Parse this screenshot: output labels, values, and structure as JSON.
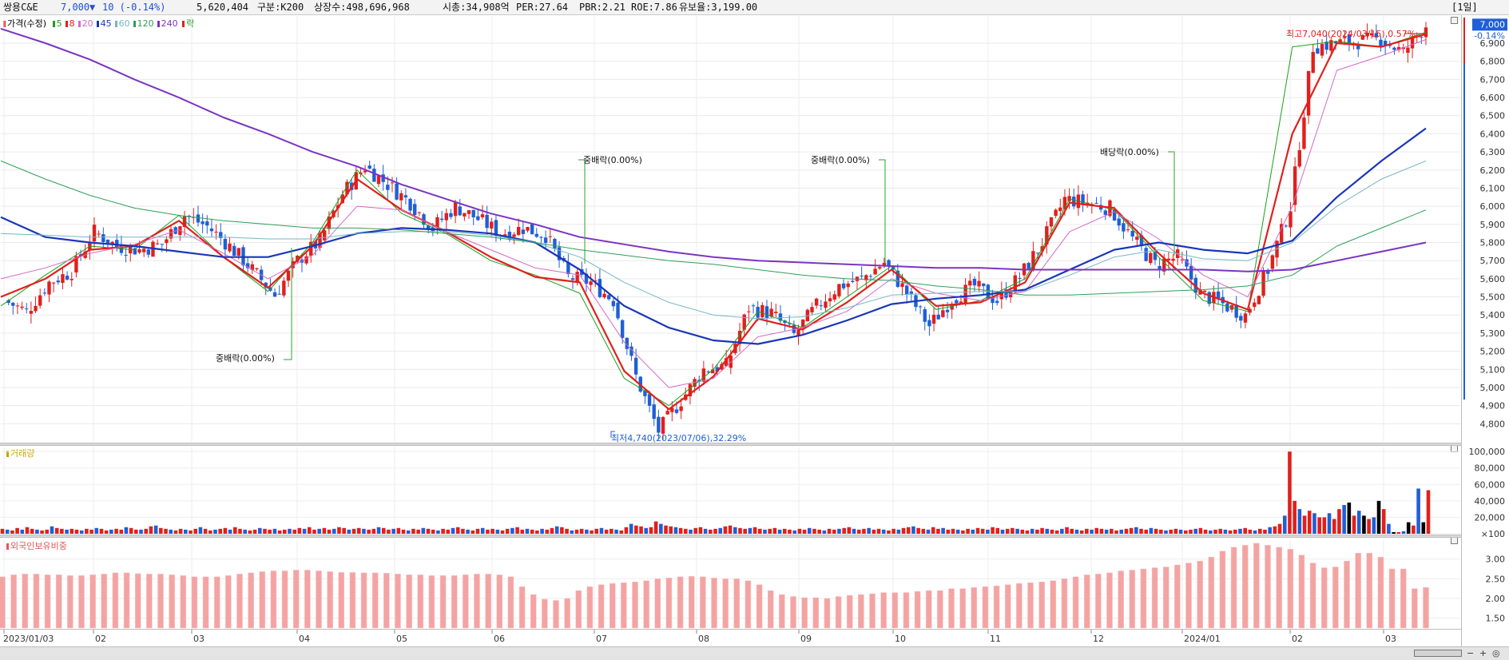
{
  "header": {
    "name": "쌍용C&E",
    "price": "7,000",
    "arrow": "▼",
    "change": "10 (-0.14%)",
    "volume": "5,620,404",
    "market": "구분:K200",
    "shares": "상장수:498,696,968",
    "cap": "시총:34,908억",
    "per": "PER:27.64",
    "pbr": "PBR:2.21",
    "roe": "ROE:7.86",
    "float": "유보율:3,199.00",
    "period": "[1일]"
  },
  "legend": {
    "price": "가격(수정)",
    "ma": [
      {
        "label": "5",
        "color": "#1a9f1a"
      },
      {
        "label": "8",
        "color": "#e0201c"
      },
      {
        "label": "20",
        "color": "#d36ac6"
      },
      {
        "label": "45",
        "color": "#1936b8"
      },
      {
        "label": "60",
        "color": "#76b6c6"
      },
      {
        "label": "120",
        "color": "#2e9f58"
      },
      {
        "label": "240",
        "color": "#7a34c4"
      }
    ],
    "ex": "락"
  },
  "panes": {
    "volume_title": "거래량",
    "foreign_title": "외국인보유비중"
  },
  "annotations": {
    "high": "최고7,040(2024/03/15),0.57%",
    "low": "최저4,740(2023/07/06),32.29%",
    "ex_labels": [
      "중배락(0.00%)",
      "중배락(0.00%)",
      "중배락(0.00%)",
      "배당락(0.00%)"
    ]
  },
  "price_badge": {
    "value": "7,000",
    "change": "-0.14%"
  },
  "colors": {
    "up": "#e0201c",
    "down": "#1f5fd6",
    "volume_up": "#e0201c",
    "volume_down": "#1f5fd6",
    "volume_flat": "#000000",
    "foreign_fill": "#f4a3a3",
    "foreign_edge": "#e35656"
  },
  "chart_data": [
    {
      "type": "candlestick",
      "title": "가격(수정)",
      "ylim": [
        4700,
        7050
      ],
      "yticks": [
        4800,
        4900,
        5000,
        5100,
        5200,
        5300,
        5400,
        5500,
        5600,
        5700,
        5800,
        5900,
        6000,
        6100,
        6200,
        6300,
        6400,
        6500,
        6600,
        6700,
        6800,
        6900
      ],
      "ytick_labels": [
        "4,800",
        "4,900",
        "5,000",
        "5,100",
        "5,200",
        "5,300",
        "5,400",
        "5,500",
        "5,600",
        "5,700",
        "5,800",
        "5,900",
        "6,000",
        "6,100",
        "6,200",
        "6,300",
        "6,400",
        "6,500",
        "6,600",
        "6,700",
        "6,800",
        "6,900"
      ],
      "x": [
        "2023/01/03",
        "02",
        "03",
        "04",
        "05",
        "06",
        "07",
        "08",
        "09",
        "10",
        "11",
        "12",
        "2024/01",
        "02",
        "03"
      ],
      "close_path": [
        [
          "2023/01/03",
          5480
        ],
        [
          "2023/01/10",
          5420
        ],
        [
          "2023/01/17",
          5580
        ],
        [
          "2023/01/24",
          5640
        ],
        [
          "2023/01/31",
          5860
        ],
        [
          "2023/02/07",
          5780
        ],
        [
          "2023/02/14",
          5760
        ],
        [
          "2023/02/21",
          5790
        ],
        [
          "2023/02/28",
          5950
        ],
        [
          "2023/03/07",
          5890
        ],
        [
          "2023/03/14",
          5780
        ],
        [
          "2023/03/21",
          5650
        ],
        [
          "2023/03/28",
          5510
        ],
        [
          "2023/04/04",
          5700
        ],
        [
          "2023/04/11",
          5810
        ],
        [
          "2023/04/18",
          6070
        ],
        [
          "2023/04/25",
          6220
        ],
        [
          "2023/05/02",
          6120
        ],
        [
          "2023/05/09",
          6020
        ],
        [
          "2023/05/16",
          5880
        ],
        [
          "2023/05/23",
          6000
        ],
        [
          "2023/05/30",
          5930
        ],
        [
          "2023/06/06",
          5850
        ],
        [
          "2023/06/13",
          5880
        ],
        [
          "2023/06/20",
          5840
        ],
        [
          "2023/06/27",
          5610
        ],
        [
          "2023/07/04",
          5580
        ],
        [
          "2023/07/11",
          5480
        ],
        [
          "2023/07/18",
          5060
        ],
        [
          "2023/07/25",
          4760
        ],
        [
          "2023/08/01",
          4930
        ],
        [
          "2023/08/08",
          5100
        ],
        [
          "2023/08/15",
          5120
        ],
        [
          "2023/08/22",
          5440
        ],
        [
          "2023/08/29",
          5410
        ],
        [
          "2023/09/05",
          5290
        ],
        [
          "2023/09/12",
          5450
        ],
        [
          "2023/09/19",
          5560
        ],
        [
          "2023/09/26",
          5600
        ],
        [
          "2023/10/03",
          5690
        ],
        [
          "2023/10/10",
          5520
        ],
        [
          "2023/10/17",
          5340
        ],
        [
          "2023/10/24",
          5490
        ],
        [
          "2023/10/31",
          5560
        ],
        [
          "2023/11/07",
          5480
        ],
        [
          "2023/11/14",
          5610
        ],
        [
          "2023/11/21",
          5800
        ],
        [
          "2023/11/28",
          6040
        ],
        [
          "2023/12/05",
          6020
        ],
        [
          "2023/12/12",
          5990
        ],
        [
          "2023/12/19",
          5820
        ],
        [
          "2023/12/26",
          5680
        ],
        [
          "2024/01/02",
          5720
        ],
        [
          "2024/01/09",
          5520
        ],
        [
          "2024/01/16",
          5460
        ],
        [
          "2024/01/23",
          5400
        ],
        [
          "2024/01/30",
          5650
        ],
        [
          "2024/02/06",
          6000
        ],
        [
          "2024/02/13",
          6880
        ],
        [
          "2024/02/20",
          6900
        ],
        [
          "2024/02/27",
          6910
        ],
        [
          "2024/03/05",
          6920
        ],
        [
          "2024/03/12",
          6850
        ],
        [
          "2024/03/19",
          7000
        ]
      ],
      "high": {
        "date": "2024/03/15",
        "value": 7040
      },
      "low": {
        "date": "2023/07/06",
        "value": 4740
      },
      "series": [
        {
          "name": "5",
          "values": [
            5450,
            5620,
            5780,
            5760,
            5950,
            5720,
            5530,
            5800,
            6200,
            5960,
            5850,
            5700,
            5620,
            5520,
            5050,
            4900,
            5100,
            5420,
            5330,
            5500,
            5670,
            5430,
            5480,
            5600,
            6040,
            5980,
            5720,
            5480,
            5420,
            6880,
            6910,
            6880,
            6960
          ]
        },
        {
          "name": "8",
          "values": [
            5500,
            5600,
            5760,
            5780,
            5920,
            5720,
            5550,
            5780,
            6150,
            5980,
            5860,
            5720,
            5610,
            5580,
            5090,
            4880,
            5060,
            5380,
            5320,
            5470,
            5650,
            5450,
            5470,
            5580,
            6020,
            5990,
            5740,
            5520,
            5430,
            6400,
            6900,
            6880,
            6950
          ]
        },
        {
          "name": "20",
          "values": [
            5600,
            5660,
            5740,
            5790,
            5870,
            5740,
            5600,
            5730,
            6000,
            5980,
            5860,
            5760,
            5660,
            5620,
            5250,
            5000,
            5050,
            5280,
            5330,
            5420,
            5600,
            5520,
            5480,
            5530,
            5860,
            5970,
            5820,
            5620,
            5500,
            6000,
            6750,
            6830,
            6920
          ]
        },
        {
          "name": "45",
          "values": [
            5940,
            5830,
            5800,
            5780,
            5750,
            5720,
            5720,
            5780,
            5850,
            5880,
            5870,
            5850,
            5800,
            5650,
            5450,
            5330,
            5260,
            5240,
            5290,
            5370,
            5460,
            5490,
            5510,
            5540,
            5650,
            5760,
            5800,
            5760,
            5740,
            5810,
            6050,
            6250,
            6430
          ]
        },
        {
          "name": "60",
          "values": [
            5850,
            5840,
            5830,
            5830,
            5830,
            5830,
            5820,
            5820,
            5850,
            5860,
            5860,
            5840,
            5800,
            5720,
            5580,
            5470,
            5400,
            5380,
            5390,
            5440,
            5510,
            5520,
            5530,
            5530,
            5620,
            5720,
            5760,
            5710,
            5700,
            5800,
            6000,
            6150,
            6250
          ]
        },
        {
          "name": "120",
          "values": [
            6250,
            6150,
            6060,
            5990,
            5950,
            5920,
            5900,
            5880,
            5880,
            5870,
            5850,
            5830,
            5800,
            5760,
            5730,
            5700,
            5680,
            5650,
            5620,
            5600,
            5590,
            5560,
            5540,
            5510,
            5510,
            5520,
            5530,
            5540,
            5560,
            5620,
            5780,
            5880,
            5980
          ]
        },
        {
          "name": "240",
          "values": [
            6980,
            6900,
            6810,
            6700,
            6600,
            6490,
            6400,
            6300,
            6220,
            6120,
            6040,
            5960,
            5900,
            5830,
            5790,
            5750,
            5720,
            5700,
            5690,
            5680,
            5670,
            5660,
            5660,
            5650,
            5650,
            5650,
            5650,
            5650,
            5640,
            5650,
            5700,
            5750,
            5800
          ]
        }
      ]
    },
    {
      "type": "bar",
      "title": "거래량",
      "ylim": [
        0,
        105000
      ],
      "yticks": [
        100,
        20000,
        40000,
        60000,
        80000,
        100000
      ],
      "ytick_labels": [
        "×100",
        "20,000",
        "40,000",
        "60,000",
        "80,000",
        "100,000"
      ],
      "values": [
        6000,
        5000,
        4000,
        7000,
        5000,
        8000,
        6000,
        5000,
        4000,
        5000,
        9000,
        7000,
        6000,
        5000,
        6000,
        5000,
        4000,
        6000,
        5000,
        7000,
        6000,
        4000,
        5000,
        6000,
        5000,
        8000,
        7000,
        5000,
        5000,
        6000,
        9000,
        10000,
        7000,
        6000,
        5000,
        4000,
        6000,
        5000,
        4000,
        6000,
        8000,
        6000,
        4000,
        5000,
        6000,
        7000,
        5000,
        8000,
        6000,
        5000,
        4000,
        5000,
        7000,
        6000,
        5000,
        6000,
        4000,
        5000,
        6000,
        5000,
        7000,
        6000,
        8000,
        5000,
        6000,
        7000,
        5000,
        6000,
        8000,
        7000,
        5000,
        6000,
        7000,
        6000,
        5000,
        6000,
        8000,
        7000,
        5000,
        6000,
        7000,
        5000,
        4000,
        6000,
        5000,
        7000,
        6000,
        5000,
        4000,
        6000,
        5000,
        7000,
        8000,
        6000,
        5000,
        4000,
        6000,
        7000,
        5000,
        6000,
        5000,
        4000,
        6000,
        7000,
        8000,
        5000,
        6000,
        5000,
        4000,
        6000,
        5000,
        7000,
        9000,
        8000,
        6000,
        4000,
        5000,
        6000,
        5000,
        4000,
        6000,
        7000,
        5000,
        6000,
        5000,
        4000,
        8000,
        12000,
        10000,
        9000,
        7000,
        8000,
        15000,
        12000,
        10000,
        9000,
        8000,
        7000,
        6000,
        5000,
        7000,
        8000,
        6000,
        5000,
        6000,
        7000,
        9000,
        10000,
        8000,
        7000,
        6000,
        7000,
        8000,
        6000,
        5000,
        6000,
        7000,
        5000,
        6000,
        5000,
        4000,
        6000,
        5000,
        7000,
        6000,
        5000,
        4000,
        6000,
        5000,
        6000,
        7000,
        8000,
        6000,
        5000,
        6000,
        7000,
        5000,
        6000,
        5000,
        4000,
        6000,
        5000,
        7000,
        8000,
        9000,
        7000,
        6000,
        5000,
        8000,
        6000,
        7000,
        5000,
        6000,
        5000,
        4000,
        6000,
        5000,
        7000,
        6000,
        5000,
        8000,
        7000,
        5000,
        6000,
        7000,
        6000,
        5000,
        4000,
        6000,
        5000,
        7000,
        6000,
        5000,
        4000,
        6000,
        8000,
        6000,
        5000,
        4000,
        6000,
        5000,
        7000,
        6000,
        5000,
        6000,
        4000,
        5000,
        6000,
        7000,
        8000,
        6000,
        5000,
        7000,
        6000,
        5000,
        4000,
        5000,
        6000,
        5000,
        4000,
        5000,
        6000,
        7000,
        5000,
        4000,
        5000,
        6000,
        5000,
        4000,
        5000,
        6000,
        7000,
        5000,
        4000,
        6000,
        5000,
        8000,
        9000,
        12000,
        22000,
        100000,
        40000,
        30000,
        22000,
        28000,
        25000,
        20000,
        20000,
        25000,
        18000,
        30000,
        35000,
        38000,
        22000,
        28000,
        22000,
        18000,
        20000,
        40000,
        30000,
        12000,
        2000,
        2000,
        3000,
        14000,
        10000,
        55000,
        14000,
        53000
      ]
    },
    {
      "type": "area",
      "title": "외국인보유비중",
      "ylim": [
        1.25,
        3.5
      ],
      "yticks": [
        1.5,
        2.0,
        2.5,
        3.0
      ],
      "ytick_labels": [
        "1.50",
        "2.00",
        "2.50",
        "3.00"
      ],
      "values": [
        2.55,
        2.6,
        2.62,
        2.62,
        2.6,
        2.6,
        2.58,
        2.58,
        2.6,
        2.62,
        2.65,
        2.65,
        2.63,
        2.62,
        2.62,
        2.6,
        2.58,
        2.55,
        2.55,
        2.55,
        2.58,
        2.62,
        2.65,
        2.68,
        2.7,
        2.7,
        2.72,
        2.72,
        2.7,
        2.68,
        2.66,
        2.66,
        2.65,
        2.65,
        2.64,
        2.62,
        2.6,
        2.6,
        2.58,
        2.58,
        2.58,
        2.6,
        2.62,
        2.62,
        2.6,
        2.55,
        2.3,
        2.1,
        1.98,
        1.95,
        2.0,
        2.2,
        2.3,
        2.35,
        2.38,
        2.4,
        2.42,
        2.45,
        2.5,
        2.52,
        2.55,
        2.56,
        2.55,
        2.52,
        2.5,
        2.5,
        2.45,
        2.35,
        2.2,
        2.1,
        2.05,
        2.02,
        2.02,
        2.0,
        2.05,
        2.08,
        2.1,
        2.12,
        2.15,
        2.15,
        2.15,
        2.18,
        2.2,
        2.2,
        2.25,
        2.25,
        2.28,
        2.3,
        2.32,
        2.35,
        2.38,
        2.4,
        2.42,
        2.45,
        2.5,
        2.55,
        2.6,
        2.62,
        2.65,
        2.7,
        2.72,
        2.75,
        2.78,
        2.8,
        2.85,
        2.9,
        2.95,
        3.05,
        3.2,
        3.3,
        3.35,
        3.4,
        3.35,
        3.3,
        3.25,
        3.1,
        2.9,
        2.78,
        2.8,
        2.95,
        3.15,
        3.15,
        3.05,
        2.75,
        2.75,
        2.25,
        2.28
      ]
    }
  ],
  "zoom_controls": [
    "−",
    "+",
    "◎"
  ]
}
